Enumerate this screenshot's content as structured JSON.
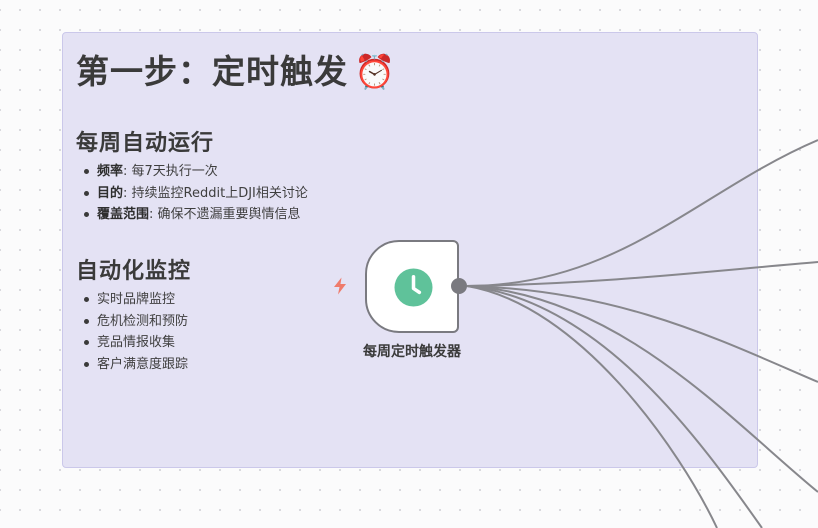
{
  "sticky_note": {
    "title": "第一步：定时触发",
    "title_emoji": "⏰",
    "section1": {
      "heading": "每周自动运行",
      "items": [
        {
          "label": "频率",
          "text": ": 每7天执行一次"
        },
        {
          "label": "目的",
          "text": ": 持续监控Reddit上DJI相关讨论"
        },
        {
          "label": "覆盖范围",
          "text": ": 确保不遗漏重要舆情信息"
        }
      ]
    },
    "section2": {
      "heading": "自动化监控",
      "items": [
        "实时品牌监控",
        "危机检测和预防",
        "竞品情报收集",
        "客户满意度跟踪"
      ]
    }
  },
  "trigger_node": {
    "label": "每周定时触发器",
    "icon": "clock-icon",
    "trigger_indicator_icon": "lightning-bolt-icon"
  },
  "colors": {
    "sticky_background": "#e4e2f4",
    "sticky_border": "#cbc8ea",
    "clock_green": "#5fc29a",
    "bolt_red": "#ef7b6b",
    "connection_gray": "#87878c",
    "node_border": "#7a7a80"
  }
}
